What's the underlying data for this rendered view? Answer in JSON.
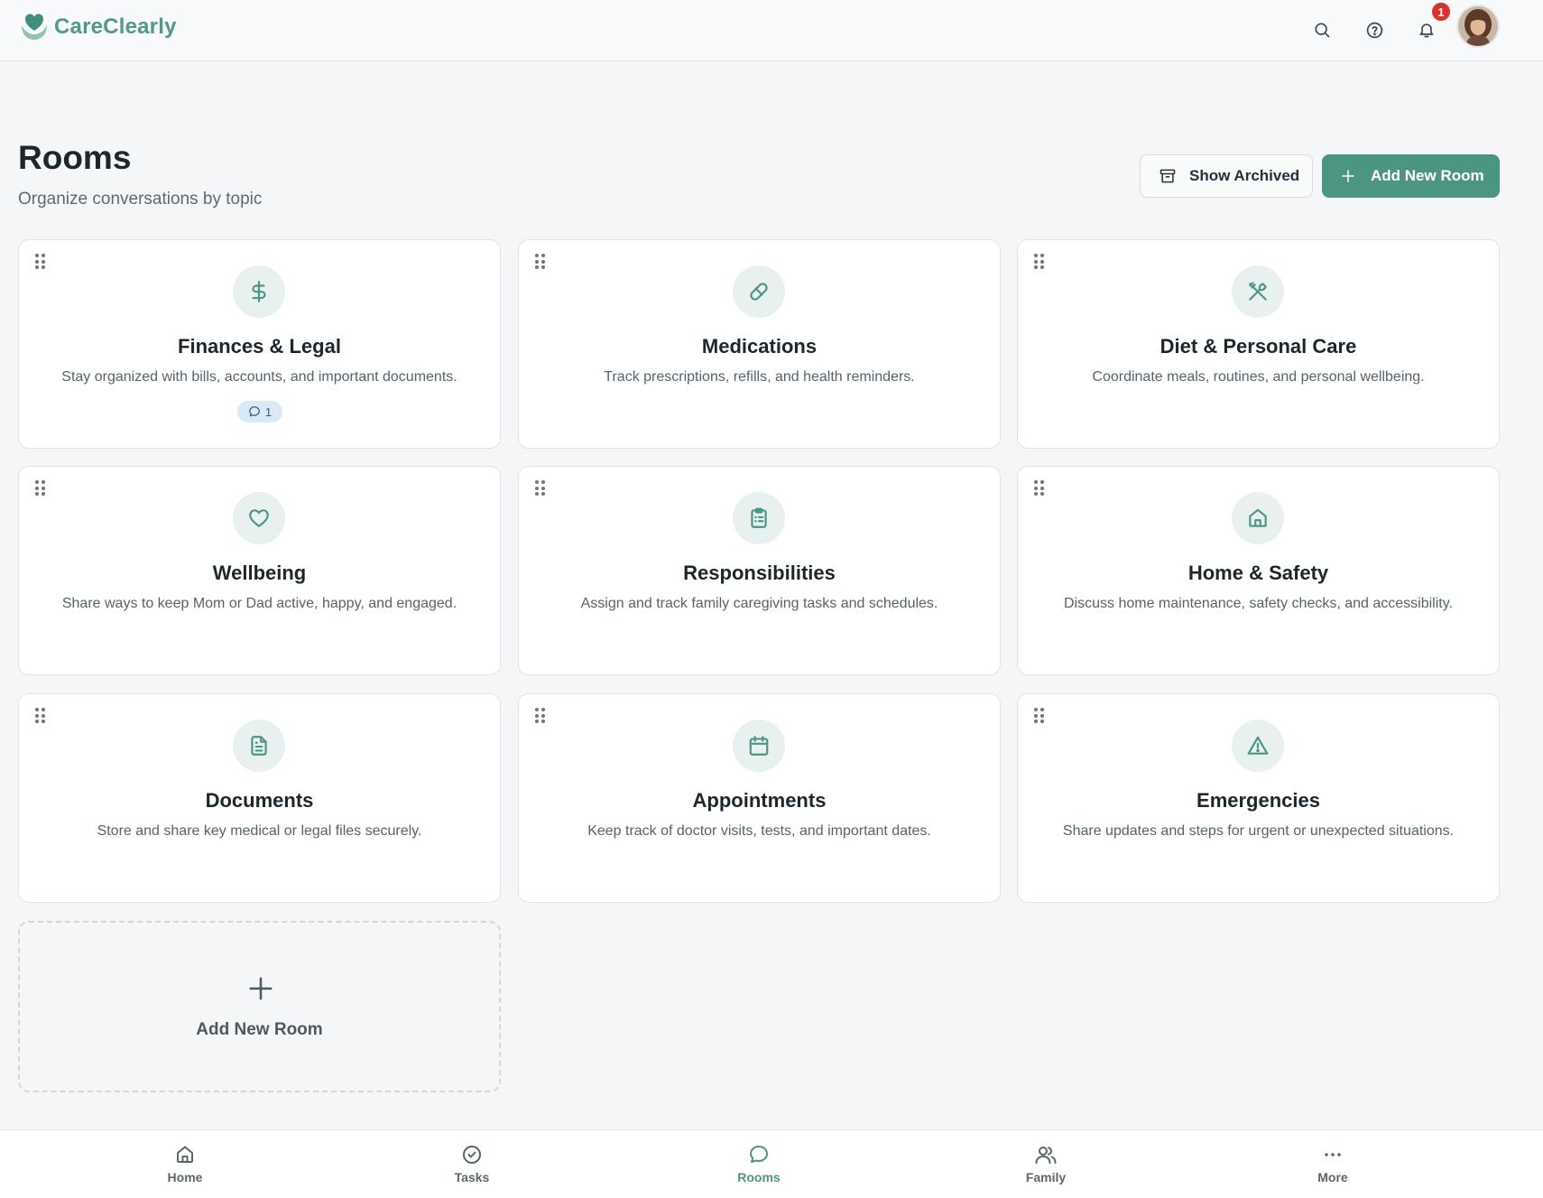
{
  "brand": {
    "name": "CareClearly",
    "accent": "#4d9583"
  },
  "header": {
    "icons": [
      "search-icon",
      "help-icon",
      "bell-icon"
    ],
    "notification_count": "1",
    "badge_color": "#d9322d"
  },
  "page": {
    "title": "Rooms",
    "subtitle": "Organize conversations by topic",
    "show_archived_label": "Show Archived",
    "add_room_label": "Add New Room"
  },
  "rooms": [
    {
      "title": "Finances & Legal",
      "desc": "Stay organized with bills, accounts, and important documents.",
      "icon": "dollar-icon",
      "messages": "1"
    },
    {
      "title": "Medications",
      "desc": "Track prescriptions, refills, and health reminders.",
      "icon": "pill-icon"
    },
    {
      "title": "Diet & Personal Care",
      "desc": "Coordinate meals, routines, and personal wellbeing.",
      "icon": "utensils-icon"
    },
    {
      "title": "Wellbeing",
      "desc": "Share ways to keep Mom or Dad active, happy, and engaged.",
      "icon": "heart-icon"
    },
    {
      "title": "Responsibilities",
      "desc": "Assign and track family caregiving tasks and schedules.",
      "icon": "clipboard-icon"
    },
    {
      "title": "Home & Safety",
      "desc": "Discuss home maintenance, safety checks, and accessibility.",
      "icon": "house-icon"
    },
    {
      "title": "Documents",
      "desc": "Store and share key medical or legal files securely.",
      "icon": "document-icon"
    },
    {
      "title": "Appointments",
      "desc": "Keep track of doctor visits, tests, and important dates.",
      "icon": "calendar-icon"
    },
    {
      "title": "Emergencies",
      "desc": "Share updates and steps for urgent or unexpected situations.",
      "icon": "warning-icon"
    }
  ],
  "add_card": {
    "label": "Add New Room"
  },
  "bottom_nav": [
    {
      "label": "Home",
      "icon": "home-icon"
    },
    {
      "label": "Tasks",
      "icon": "check-circle-icon"
    },
    {
      "label": "Rooms",
      "icon": "chat-icon",
      "active": true
    },
    {
      "label": "Family",
      "icon": "users-icon"
    },
    {
      "label": "More",
      "icon": "more-icon"
    }
  ]
}
